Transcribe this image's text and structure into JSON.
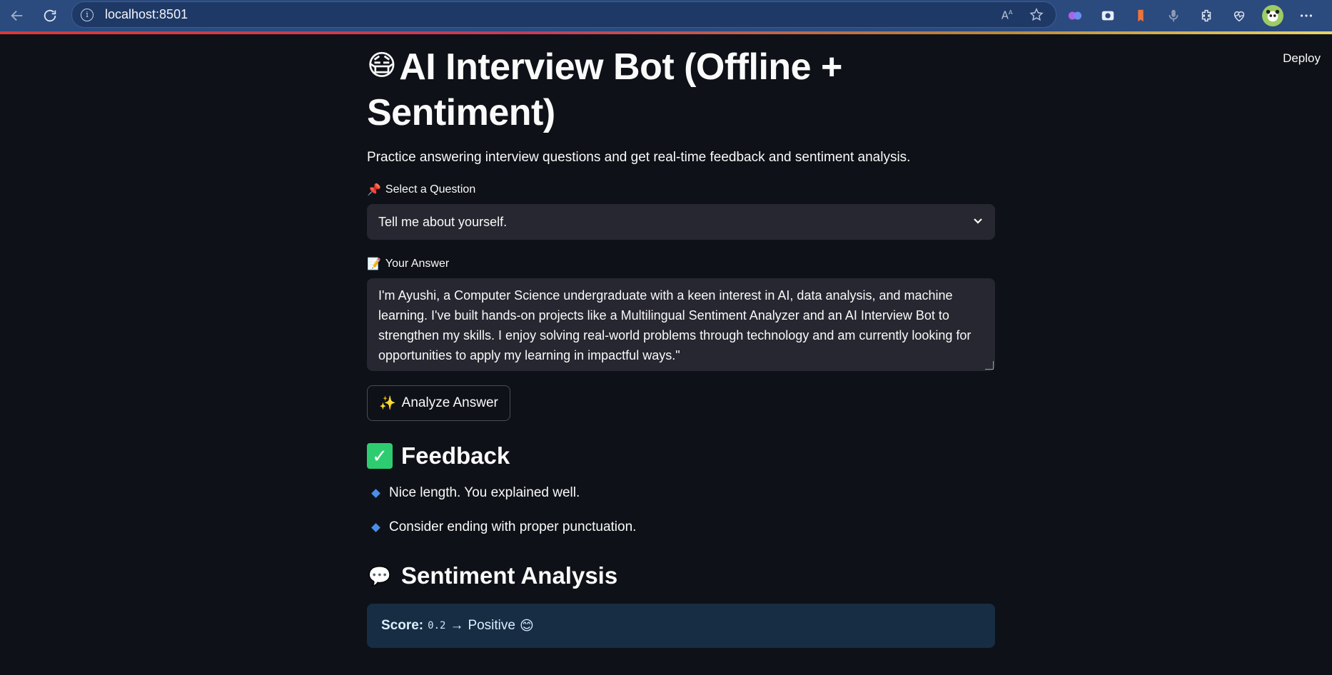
{
  "browser": {
    "url": "localhost:8501",
    "info_glyph": "i",
    "back_icon": "arrow-left-icon",
    "reload_icon": "reload-icon"
  },
  "header": {
    "deploy_label": "Deploy"
  },
  "app": {
    "title_emoji": "😷",
    "title": "AI Interview Bot (Offline + Sentiment)",
    "subtitle": "Practice answering interview questions and get real-time feedback and sentiment analysis."
  },
  "question": {
    "label_icon": "📌",
    "label": "Select a Question",
    "selected": "Tell me about yourself.",
    "chevron": "⌄"
  },
  "answer": {
    "label_icon": "📝",
    "label": "Your Answer",
    "value": "I'm Ayushi, a Computer Science undergraduate with a keen interest in AI, data analysis, and machine learning. I've built hands-on projects like a Multilingual Sentiment Analyzer and an AI Interview Bot to strengthen my skills. I enjoy solving real-world problems through technology and am currently looking for opportunities to apply my learning in impactful ways.\""
  },
  "analyze_button": {
    "icon": "✨",
    "label": "Analyze Answer"
  },
  "feedback": {
    "icon": "✓",
    "heading": "Feedback",
    "items": [
      "Nice length. You explained well.",
      "Consider ending with proper punctuation."
    ]
  },
  "sentiment": {
    "icon": "💬",
    "heading": "Sentiment Analysis",
    "score_label": "Score:",
    "score_value": "0.2",
    "arrow": "→",
    "result": "Positive",
    "result_emoji": "😊"
  },
  "colors": {
    "background": "#0e1117",
    "input_bg": "#262730",
    "info_box_bg": "#172d43",
    "bullet": "#4a8ee8",
    "check": "#2ecc71"
  }
}
